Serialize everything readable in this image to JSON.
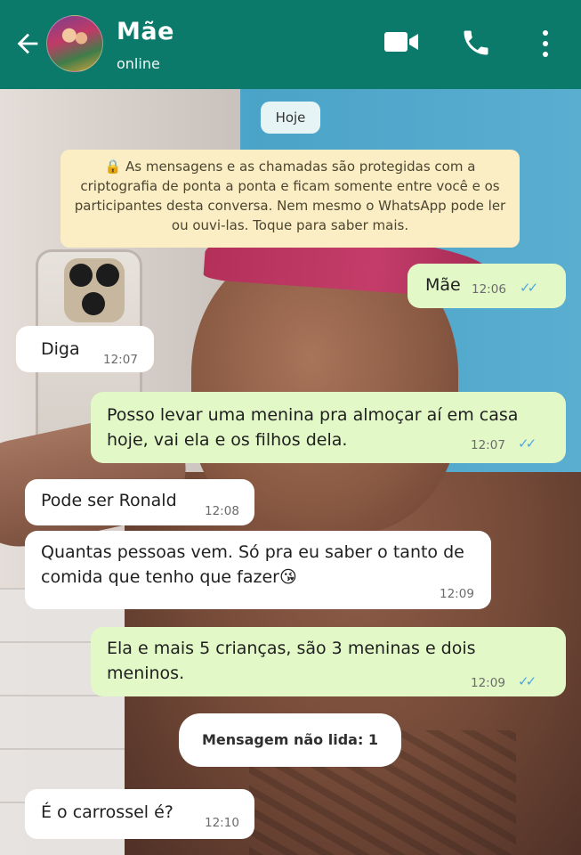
{
  "header": {
    "back_icon": "arrow-left-icon",
    "contact_name": "Mãe",
    "status": "online",
    "icons": [
      "video-call-icon",
      "phone-icon",
      "more-vert-icon"
    ],
    "color": "#0b7a6a"
  },
  "chat": {
    "date_label": "Hoje",
    "encryption_notice": "🔒 As mensagens e as chamadas são protegidas com a criptografia de ponta a ponta e ficam somente entre você e os participantes desta conversa. Nem mesmo o WhatsApp pode ler ou ouvi-las. Toque para saber mais.",
    "messages": [
      {
        "direction": "out",
        "text": "Mãe",
        "time": "12:06",
        "ticks": "✓✓"
      },
      {
        "direction": "in",
        "text": "Diga",
        "time": "12:07"
      },
      {
        "direction": "out",
        "text": "Posso levar uma menina pra almoçar aí em casa hoje, vai ela e os filhos dela.",
        "time": "12:07",
        "ticks": "✓✓"
      },
      {
        "direction": "in",
        "text": "Pode ser Ronald",
        "time": "12:08"
      },
      {
        "direction": "in",
        "text": "Quantas pessoas vem. Só pra eu saber o tanto de comida que tenho que fazer😘",
        "time": "12:09"
      },
      {
        "direction": "out",
        "text": "Ela e mais 5 crianças, são 3 meninas e dois meninos.",
        "time": "12:09",
        "ticks": "✓✓"
      },
      {
        "direction": "in",
        "text": "É o carrossel é?",
        "time": "12:10"
      }
    ],
    "unread_label": "Mensagem não lida: 1",
    "colors": {
      "outgoing_bubble": "#e2f8c7",
      "incoming_bubble": "#ffffff",
      "ticks_read": "#4ea6e8"
    }
  }
}
